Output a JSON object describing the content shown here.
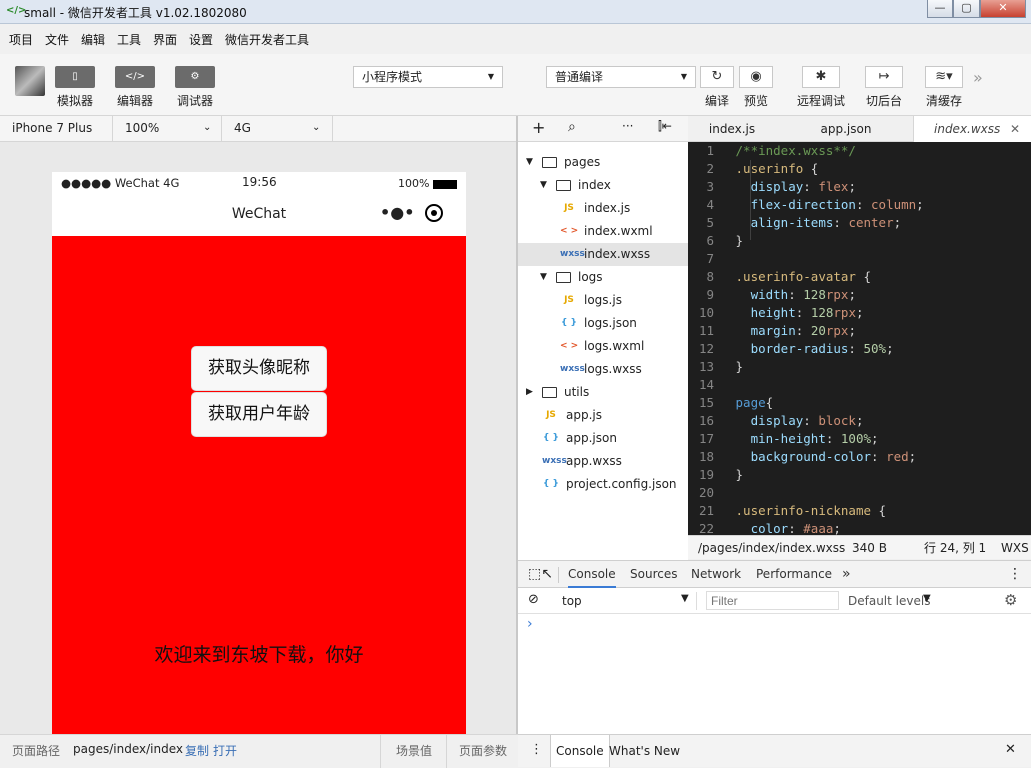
{
  "window": {
    "title": "small - 微信开发者工具 v1.02.1802080",
    "min": "—",
    "max": "▢",
    "close": "✕"
  },
  "menu": [
    "项目",
    "文件",
    "编辑",
    "工具",
    "界面",
    "设置",
    "微信开发者工具"
  ],
  "toolbar": {
    "simulator": "模拟器",
    "editor": "编辑器",
    "debugger": "调试器",
    "mode_select": "小程序模式",
    "compile_select": "普通编译",
    "compile": "编译",
    "preview": "预览",
    "remote_debug": "远程调试",
    "background": "切后台",
    "clear_cache": "清缓存"
  },
  "simbar": {
    "device": "iPhone 7 Plus",
    "zoom": "100%",
    "network": "4G"
  },
  "phone": {
    "carrier": "●●●●● WeChat 4G",
    "time": "19:56",
    "battery": "100%",
    "nav_title": "WeChat",
    "btn_avatar": "获取头像昵称",
    "btn_age": "获取用户年龄",
    "welcome": "欢迎来到东坡下载，你好"
  },
  "footer": {
    "path_label": "页面路径",
    "path": "pages/index/index",
    "copy": "复制",
    "open": "打开",
    "scene": "场景值",
    "params": "页面参数"
  },
  "tree": [
    {
      "label": "pages",
      "type": "folder",
      "level": 0,
      "open": true
    },
    {
      "label": "index",
      "type": "folder",
      "level": 1,
      "open": true
    },
    {
      "label": "index.js",
      "type": "js",
      "level": 2
    },
    {
      "label": "index.wxml",
      "type": "wxml",
      "level": 2
    },
    {
      "label": "index.wxss",
      "type": "wxss",
      "level": 2,
      "active": true
    },
    {
      "label": "logs",
      "type": "folder",
      "level": 1,
      "open": true
    },
    {
      "label": "logs.js",
      "type": "js",
      "level": 2
    },
    {
      "label": "logs.json",
      "type": "json",
      "level": 2
    },
    {
      "label": "logs.wxml",
      "type": "wxml",
      "level": 2
    },
    {
      "label": "logs.wxss",
      "type": "wxss",
      "level": 2
    },
    {
      "label": "utils",
      "type": "folder",
      "level": 0,
      "open": false
    },
    {
      "label": "app.js",
      "type": "js",
      "level": 0
    },
    {
      "label": "app.json",
      "type": "json",
      "level": 0
    },
    {
      "label": "app.wxss",
      "type": "wxss",
      "level": 0
    },
    {
      "label": "project.config.json",
      "type": "json",
      "level": 0
    }
  ],
  "file_icons": {
    "js": "JS",
    "wxml": "< >",
    "wxss": "wxss",
    "json": "{ }"
  },
  "tabs": [
    "index.js",
    "app.json",
    "index.wxss"
  ],
  "code": [
    [
      [
        "c-com",
        "/**index.wxss**/"
      ]
    ],
    [
      [
        "c-sel",
        ".userinfo"
      ],
      [
        "c-p",
        " {"
      ]
    ],
    [
      [
        "c-prop",
        "  display"
      ],
      [
        "c-p",
        ": "
      ],
      [
        "c-val",
        "flex"
      ],
      [
        "c-p",
        ";"
      ]
    ],
    [
      [
        "c-prop",
        "  flex-direction"
      ],
      [
        "c-p",
        ": "
      ],
      [
        "c-val",
        "column"
      ],
      [
        "c-p",
        ";"
      ]
    ],
    [
      [
        "c-prop",
        "  align-items"
      ],
      [
        "c-p",
        ": "
      ],
      [
        "c-val",
        "center"
      ],
      [
        "c-p",
        ";"
      ]
    ],
    [
      [
        "c-p",
        "}"
      ]
    ],
    [
      [
        "c-p",
        ""
      ]
    ],
    [
      [
        "c-sel",
        ".userinfo-avatar"
      ],
      [
        "c-p",
        " {"
      ]
    ],
    [
      [
        "c-prop",
        "  width"
      ],
      [
        "c-p",
        ": "
      ],
      [
        "c-num",
        "128"
      ],
      [
        "c-val",
        "rpx"
      ],
      [
        "c-p",
        ";"
      ]
    ],
    [
      [
        "c-prop",
        "  height"
      ],
      [
        "c-p",
        ": "
      ],
      [
        "c-num",
        "128"
      ],
      [
        "c-val",
        "rpx"
      ],
      [
        "c-p",
        ";"
      ]
    ],
    [
      [
        "c-prop",
        "  margin"
      ],
      [
        "c-p",
        ": "
      ],
      [
        "c-num",
        "20"
      ],
      [
        "c-val",
        "rpx"
      ],
      [
        "c-p",
        ";"
      ]
    ],
    [
      [
        "c-prop",
        "  border-radius"
      ],
      [
        "c-p",
        ": "
      ],
      [
        "c-num",
        "50%"
      ],
      [
        "c-p",
        ";"
      ]
    ],
    [
      [
        "c-p",
        "}"
      ]
    ],
    [
      [
        "c-p",
        ""
      ]
    ],
    [
      [
        "c-sel2",
        "page"
      ],
      [
        "c-p",
        "{"
      ]
    ],
    [
      [
        "c-prop",
        "  display"
      ],
      [
        "c-p",
        ": "
      ],
      [
        "c-val",
        "block"
      ],
      [
        "c-p",
        ";"
      ]
    ],
    [
      [
        "c-prop",
        "  min-height"
      ],
      [
        "c-p",
        ": "
      ],
      [
        "c-num",
        "100%"
      ],
      [
        "c-p",
        ";"
      ]
    ],
    [
      [
        "c-prop",
        "  background-color"
      ],
      [
        "c-p",
        ": "
      ],
      [
        "c-val",
        "red"
      ],
      [
        "c-p",
        ";"
      ]
    ],
    [
      [
        "c-p",
        "}"
      ]
    ],
    [
      [
        "c-p",
        ""
      ]
    ],
    [
      [
        "c-sel",
        ".userinfo-nickname"
      ],
      [
        "c-p",
        " {"
      ]
    ],
    [
      [
        "c-prop",
        "  color"
      ],
      [
        "c-p",
        ": "
      ],
      [
        "c-val",
        "#aaa"
      ],
      [
        "c-p",
        ";"
      ]
    ]
  ],
  "editor_status": {
    "path": "/pages/index/index.wxss",
    "size": "340 B",
    "position": "行 24, 列 1",
    "lang": "WXS"
  },
  "devtools": {
    "tabs": [
      "Console",
      "Sources",
      "Network",
      "Performance"
    ],
    "more": "»",
    "context": "top",
    "filter_placeholder": "Filter",
    "levels": "Default levels",
    "prompt": "›"
  },
  "drawer": {
    "console": "Console",
    "whats_new": "What's New",
    "close": "✕"
  }
}
